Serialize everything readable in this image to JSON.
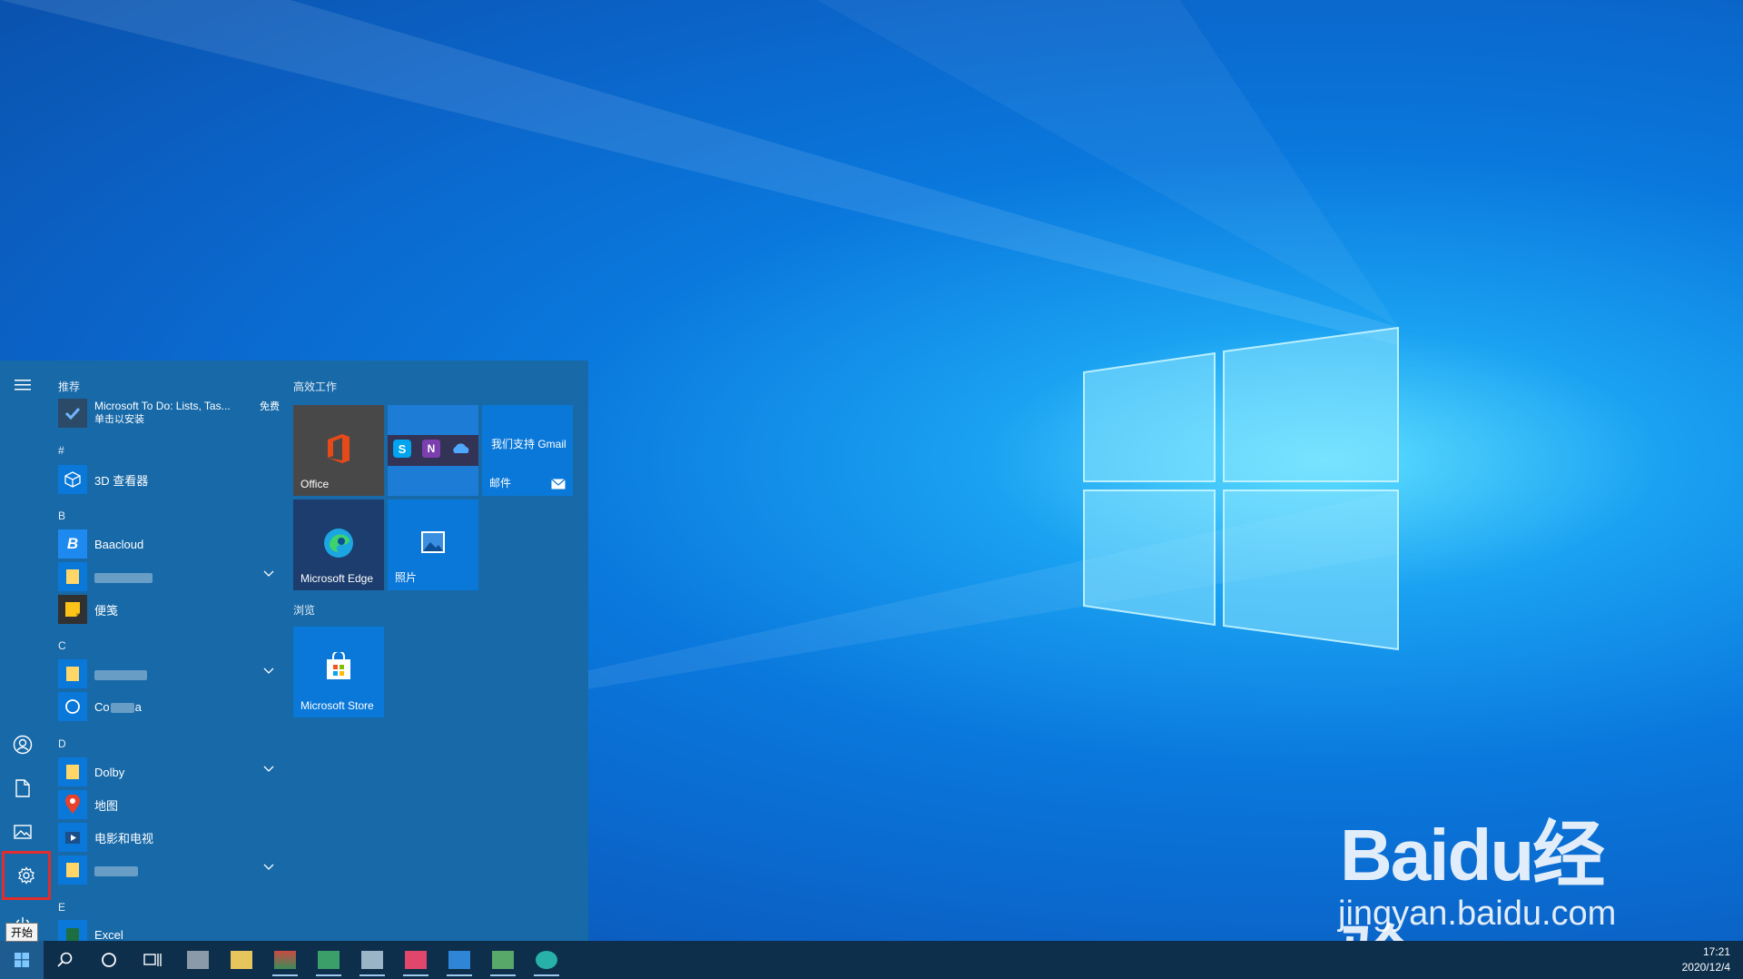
{
  "start_menu": {
    "sections": {
      "recommended": "推荐",
      "hash": "#",
      "b": "B",
      "c": "C",
      "d": "D",
      "e": "E"
    },
    "recommended_app": {
      "name": "Microsoft To Do: Lists, Tas...",
      "sub": "单击以安装",
      "badge": "免费"
    },
    "apps": {
      "viewer3d": "3D 查看器",
      "baacloud": "Baacloud",
      "sticky": "便笺",
      "cortana": "Co",
      "cortana_tail": "a",
      "dolby": "Dolby",
      "maps": "地图",
      "movies": "电影和电视",
      "excel": "Excel"
    },
    "tile_groups": {
      "productivity": "高效工作",
      "browse": "浏览"
    },
    "tiles": {
      "office": "Office",
      "mail_top": "我们支持 Gmail",
      "mail": "邮件",
      "edge": "Microsoft Edge",
      "photos": "照片",
      "store": "Microsoft Store"
    },
    "tooltip": "开始"
  },
  "icons": {
    "hamburger": "hamburger-icon",
    "user": "user-icon",
    "documents": "document-icon",
    "pictures": "pictures-icon",
    "settings": "gear-icon",
    "power": "power-icon",
    "windows": "windows-icon",
    "search": "search-icon",
    "cortana": "cortana-icon",
    "taskview": "task-view-icon"
  },
  "taskbar": {
    "time": "17:21",
    "date": "2020/12/4"
  },
  "watermark": {
    "logo_a": "Bai",
    "logo_b": "du",
    "logo_c": "经验",
    "url": "jingyan.baidu.com"
  },
  "colors": {
    "accent": "#0078d7",
    "start_bg": "#1769a8",
    "taskbar_bg": "#0d2f4c",
    "highlight_outline": "#e12d2d"
  }
}
